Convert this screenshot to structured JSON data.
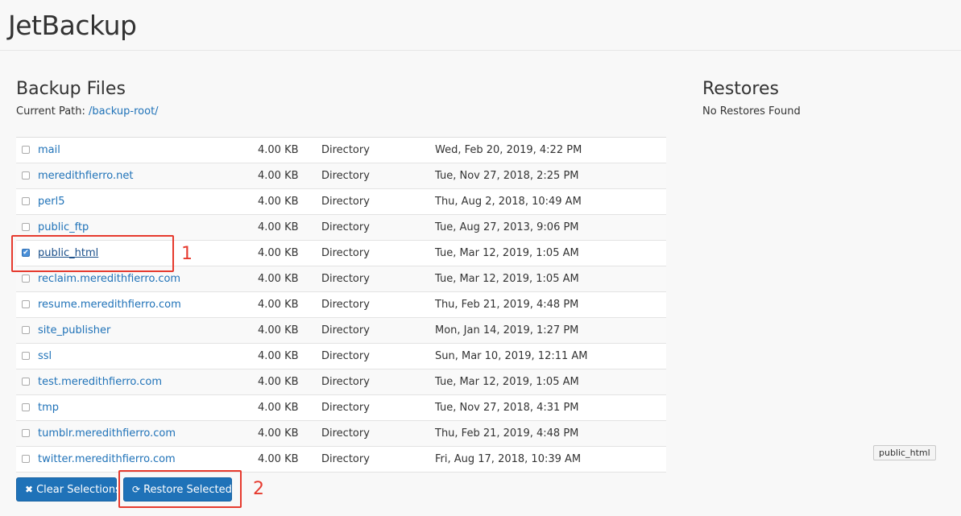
{
  "app": {
    "title": "JetBackup"
  },
  "backup_files": {
    "title": "Backup Files",
    "current_path_label": "Current Path:",
    "current_path": "/backup-root/",
    "rows": [
      {
        "name": "mail",
        "size": "4.00 KB",
        "type": "Directory",
        "date": "Wed, Feb 20, 2019, 4:22 PM",
        "checked": false
      },
      {
        "name": "meredithfierro.net",
        "size": "4.00 KB",
        "type": "Directory",
        "date": "Tue, Nov 27, 2018, 2:25 PM",
        "checked": false
      },
      {
        "name": "perl5",
        "size": "4.00 KB",
        "type": "Directory",
        "date": "Thu, Aug 2, 2018, 10:49 AM",
        "checked": false
      },
      {
        "name": "public_ftp",
        "size": "4.00 KB",
        "type": "Directory",
        "date": "Tue, Aug 27, 2013, 9:06 PM",
        "checked": false
      },
      {
        "name": "public_html",
        "size": "4.00 KB",
        "type": "Directory",
        "date": "Tue, Mar 12, 2019, 1:05 AM",
        "checked": true
      },
      {
        "name": "reclaim.meredithfierro.com",
        "size": "4.00 KB",
        "type": "Directory",
        "date": "Tue, Mar 12, 2019, 1:05 AM",
        "checked": false
      },
      {
        "name": "resume.meredithfierro.com",
        "size": "4.00 KB",
        "type": "Directory",
        "date": "Thu, Feb 21, 2019, 4:48 PM",
        "checked": false
      },
      {
        "name": "site_publisher",
        "size": "4.00 KB",
        "type": "Directory",
        "date": "Mon, Jan 14, 2019, 1:27 PM",
        "checked": false
      },
      {
        "name": "ssl",
        "size": "4.00 KB",
        "type": "Directory",
        "date": "Sun, Mar 10, 2019, 12:11 AM",
        "checked": false
      },
      {
        "name": "test.meredithfierro.com",
        "size": "4.00 KB",
        "type": "Directory",
        "date": "Tue, Mar 12, 2019, 1:05 AM",
        "checked": false
      },
      {
        "name": "tmp",
        "size": "4.00 KB",
        "type": "Directory",
        "date": "Tue, Nov 27, 2018, 4:31 PM",
        "checked": false
      },
      {
        "name": "tumblr.meredithfierro.com",
        "size": "4.00 KB",
        "type": "Directory",
        "date": "Thu, Feb 21, 2019, 4:48 PM",
        "checked": false
      },
      {
        "name": "twitter.meredithfierro.com",
        "size": "4.00 KB",
        "type": "Directory",
        "date": "Fri, Aug 17, 2018, 10:39 AM",
        "checked": false
      }
    ]
  },
  "restores": {
    "title": "Restores",
    "empty_text": "No Restores Found"
  },
  "buttons": {
    "clear": "Clear Selections",
    "restore": "Restore Selected"
  },
  "annotations": {
    "one": "1",
    "two": "2"
  },
  "tooltip": {
    "text": "public_html"
  },
  "icons": {
    "checkbox_checked": "checkmark-icon",
    "clear": "x-icon",
    "restore": "refresh-icon"
  },
  "colors": {
    "link": "#1f72b8",
    "button": "#1f72b8",
    "highlight": "#e63a2e"
  }
}
